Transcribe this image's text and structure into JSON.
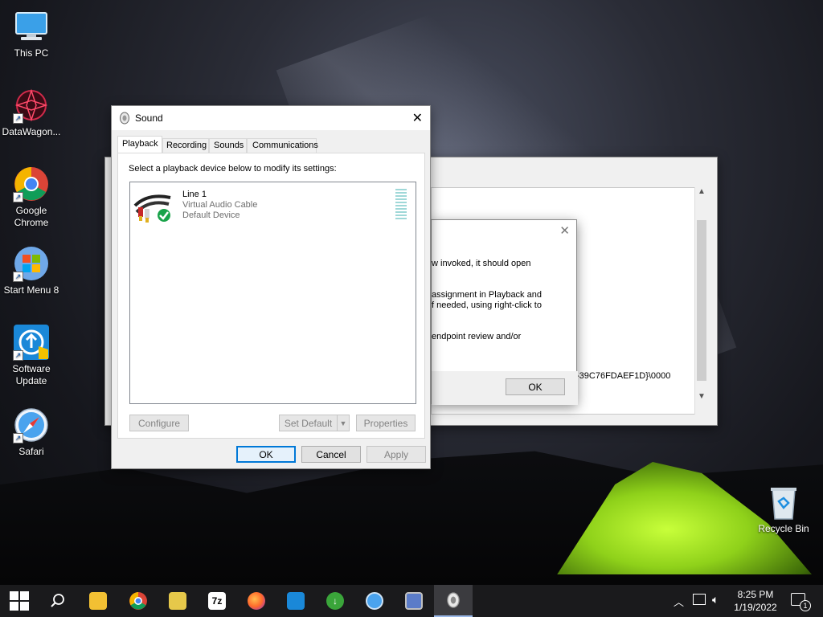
{
  "desktop": {
    "icons": [
      {
        "label": "This PC",
        "icon": "computer-icon"
      },
      {
        "label": "DataWagon...",
        "icon": "datawagon-icon"
      },
      {
        "label": "Google Chrome",
        "icon": "chrome-icon"
      },
      {
        "label": "Start Menu 8",
        "icon": "windows-orb-icon"
      },
      {
        "label": "Software Update",
        "icon": "software-update-icon"
      },
      {
        "label": "Safari",
        "icon": "safari-icon"
      },
      {
        "label": "Recycle Bin",
        "icon": "recycle-bin-icon"
      }
    ]
  },
  "bg_window": {
    "dialog_lines": [
      "w invoked, it should open",
      "assignment in Playback and",
      "f needed, using right-click to",
      "endpoint review and/or"
    ],
    "guid_text": "-39C76FDAEF1D}\\0000",
    "ok_label": "OK"
  },
  "sound": {
    "title": "Sound",
    "tabs": [
      "Playback",
      "Recording",
      "Sounds",
      "Communications"
    ],
    "instruction": "Select a playback device below to modify its settings:",
    "device": {
      "name": "Line 1",
      "desc": "Virtual Audio Cable",
      "status": "Default Device"
    },
    "buttons": {
      "configure": "Configure",
      "set_default": "Set Default",
      "properties": "Properties",
      "ok": "OK",
      "cancel": "Cancel",
      "apply": "Apply"
    }
  },
  "taskbar": {
    "time": "8:25 PM",
    "date": "1/19/2022",
    "notification_count": "1"
  },
  "colors": {
    "accent": "#0078d7",
    "check_green": "#1aa34a"
  }
}
